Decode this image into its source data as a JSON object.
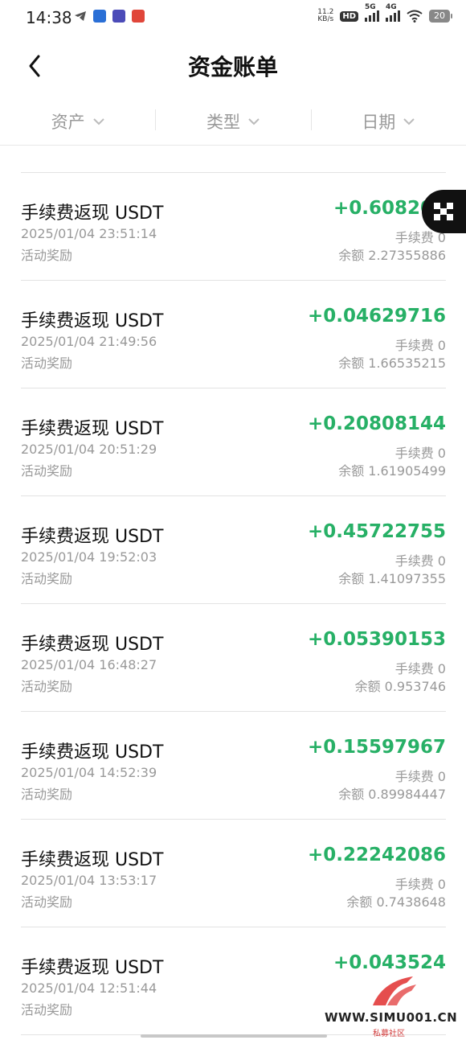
{
  "status_bar": {
    "time": "14:38",
    "net_speed_value": "11.2",
    "net_speed_unit": "KB/s",
    "hd_badge": "HD",
    "signal1_label": "5G",
    "signal2_label": "4G",
    "battery": "20"
  },
  "header": {
    "title": "资金账单"
  },
  "filters": [
    {
      "label": "资产"
    },
    {
      "label": "类型"
    },
    {
      "label": "日期"
    }
  ],
  "records": [
    {
      "name": "手续费返现 USDT",
      "datetime": "2025/01/04 23:51:14",
      "category": "活动奖励",
      "amount": "+0.608206",
      "fee": "手续费  0",
      "balance": "余额  2.27355886"
    },
    {
      "name": "手续费返现 USDT",
      "datetime": "2025/01/04 21:49:56",
      "category": "活动奖励",
      "amount": "+0.04629716",
      "fee": "手续费  0",
      "balance": "余额  1.66535215"
    },
    {
      "name": "手续费返现 USDT",
      "datetime": "2025/01/04 20:51:29",
      "category": "活动奖励",
      "amount": "+0.20808144",
      "fee": "手续费  0",
      "balance": "余额  1.61905499"
    },
    {
      "name": "手续费返现 USDT",
      "datetime": "2025/01/04 19:52:03",
      "category": "活动奖励",
      "amount": "+0.45722755",
      "fee": "手续费  0",
      "balance": "余额  1.41097355"
    },
    {
      "name": "手续费返现 USDT",
      "datetime": "2025/01/04 16:48:27",
      "category": "活动奖励",
      "amount": "+0.05390153",
      "fee": "手续费  0",
      "balance": "余额  0.953746"
    },
    {
      "name": "手续费返现 USDT",
      "datetime": "2025/01/04 14:52:39",
      "category": "活动奖励",
      "amount": "+0.15597967",
      "fee": "手续费  0",
      "balance": "余额  0.89984447"
    },
    {
      "name": "手续费返现 USDT",
      "datetime": "2025/01/04 13:53:17",
      "category": "活动奖励",
      "amount": "+0.22242086",
      "fee": "手续费  0",
      "balance": "余额  0.7438648"
    },
    {
      "name": "手续费返现 USDT",
      "datetime": "2025/01/04 12:51:44",
      "category": "活动奖励",
      "amount": "+0.043524",
      "fee": "",
      "balance": ""
    }
  ],
  "watermark": {
    "text": "WWW.SIMU001.CN",
    "sub": "私募社区"
  },
  "colors": {
    "positive": "#27b066",
    "muted": "#999999"
  },
  "icons": {
    "back": "chevron-left-icon",
    "dropdown": "chevron-down-icon",
    "float": "app-grid-icon"
  }
}
